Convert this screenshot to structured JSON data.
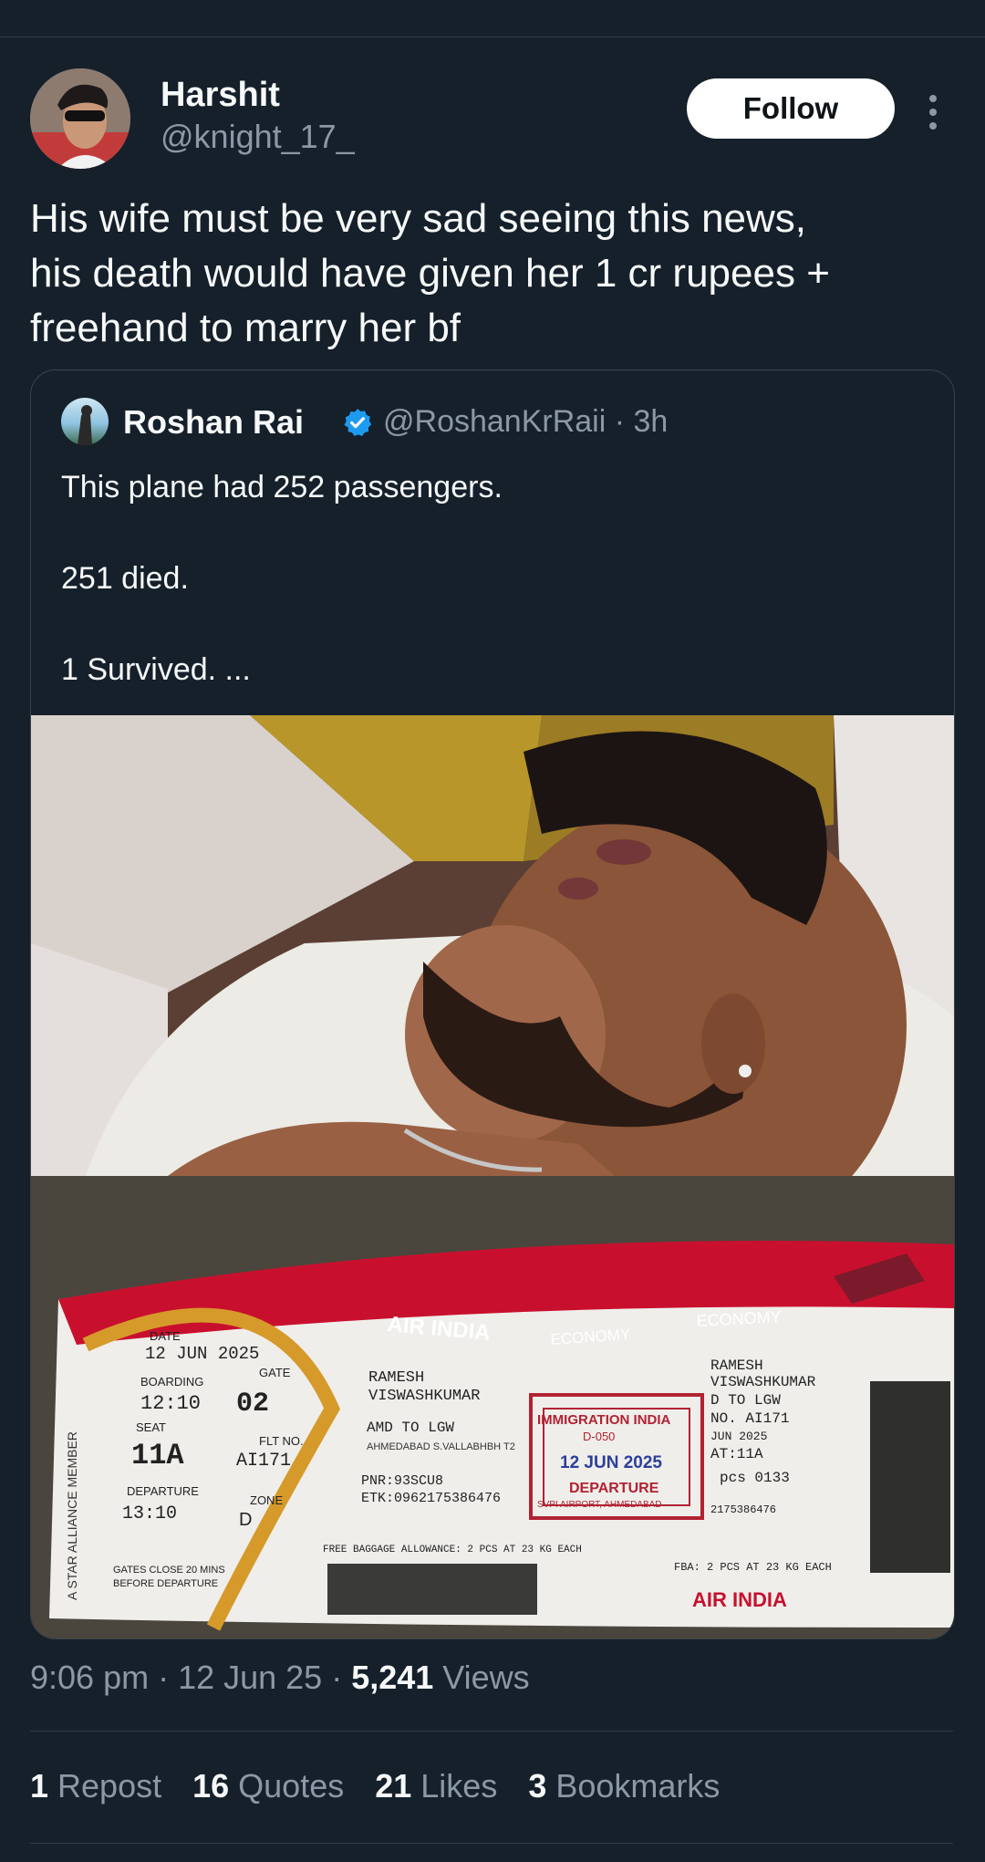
{
  "post": {
    "author_name": "Harshit",
    "author_handle": "@knight_17_",
    "follow_label": "Follow",
    "text": "His wife must be very sad seeing this news,\nhis death would have given her 1 cr rupees +\nfreehand to marry her bf"
  },
  "quoted": {
    "author_name": "Roshan Rai",
    "author_handle": "@RoshanKrRaii · 3h",
    "text": "This plane had 252 passengers.\n\n251 died.\n\n1 Survived. ...",
    "ticket": {
      "airline": "AIR INDIA",
      "cabin": "ECONOMY",
      "cabin_stub": "ECONOMY",
      "date_label": "DATE",
      "date": "12 JUN 2025",
      "boarding_label": "BOARDING",
      "boarding": "12:10",
      "gate_label": "GATE",
      "gate": "02",
      "seat_label": "SEAT",
      "seat": "11A",
      "flt_label": "FLT NO.",
      "flight": "AI171",
      "departure_label": "DEPARTURE",
      "departure": "13:10",
      "zone_label": "ZONE",
      "zone": "D",
      "passenger_1": "RAMESH",
      "passenger_2": "VISWASHKUMAR",
      "from_to": "AMD TO LGW",
      "from_airport": "AHMEDABAD S.VALLABHBH T2",
      "pnr": "PNR:93SCU8",
      "etk": "ETK:0962175386476",
      "baggage": "FREE BAGGAGE ALLOWANCE: 2 PCS AT 23 KG EACH",
      "gates_close_1": "GATES CLOSE 20 MINS",
      "gates_close_2": "BEFORE DEPARTURE",
      "alliance": "A STAR ALLIANCE MEMBER",
      "stub_route": "D TO LGW",
      "stub_flight": "NO. AI171",
      "stub_date": "JUN 2025",
      "stub_seat": "AT:11A",
      "stub_pcs": "pcs 0133",
      "stub_etk": "2175386476",
      "stub_fba": "FBA: 2 PCS AT 23 KG EACH",
      "stamp_1": "IMMIGRATION INDIA",
      "stamp_2": "D-050",
      "stamp_3": "12 JUN 2025",
      "stamp_4": "DEPARTURE",
      "stamp_5": "SVPI AIRPORT, AHMEDABAD"
    }
  },
  "meta": {
    "time": "9:06 pm · 12 Jun 25 · ",
    "views_count": "5,241",
    "views_label": " Views"
  },
  "stats": [
    {
      "count": "1",
      "label": "Repost"
    },
    {
      "count": "16",
      "label": "Quotes"
    },
    {
      "count": "21",
      "label": "Likes"
    },
    {
      "count": "3",
      "label": "Bookmarks"
    }
  ],
  "colors": {
    "background": "#15202b",
    "text": "#f7f9f9",
    "secondary": "#8b98a5",
    "verified": "#1d9bf0",
    "ticket_red": "#c8102e"
  }
}
